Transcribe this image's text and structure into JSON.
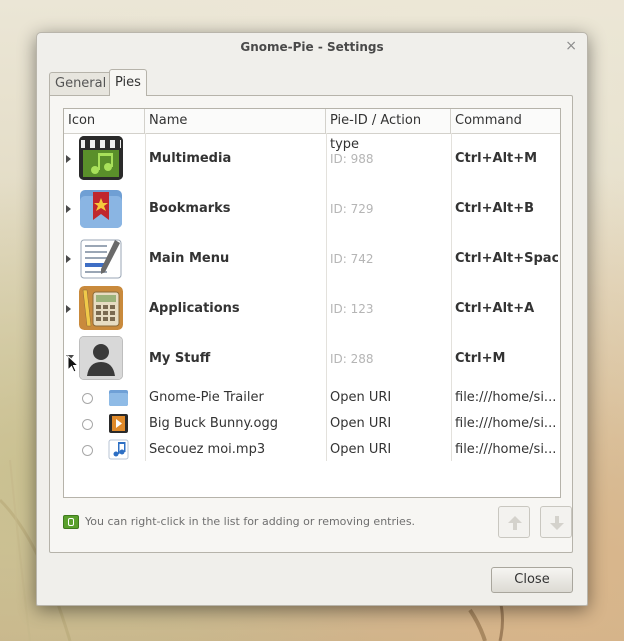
{
  "window": {
    "title": "Gnome-Pie - Settings"
  },
  "tabs": [
    {
      "label": "General",
      "active": false
    },
    {
      "label": "Pies",
      "active": true
    }
  ],
  "columns": {
    "icon": "Icon",
    "name": "Name",
    "pie_id": "Pie-ID / Action type",
    "command": "Command"
  },
  "pies": [
    {
      "name": "Multimedia",
      "id": "ID: 988",
      "command": "Ctrl+Alt+M",
      "icon": "multimedia-clapper-icon",
      "expanded": false
    },
    {
      "name": "Bookmarks",
      "id": "ID: 729",
      "command": "Ctrl+Alt+B",
      "icon": "bookmarks-folder-icon",
      "expanded": false
    },
    {
      "name": "Main Menu",
      "id": "ID: 742",
      "command": "Ctrl+Alt+Space",
      "icon": "main-menu-notepad-icon",
      "expanded": false
    },
    {
      "name": "Applications",
      "id": "ID: 123",
      "command": "Ctrl+Alt+A",
      "icon": "applications-calculator-icon",
      "expanded": false
    },
    {
      "name": "My Stuff",
      "id": "ID: 288",
      "command": "Ctrl+M",
      "icon": "my-stuff-user-icon",
      "expanded": true
    }
  ],
  "slices": [
    {
      "name": "Gnome-Pie Trailer",
      "type": "Open URI",
      "command": "file:///home/si...",
      "icon": "folder-icon"
    },
    {
      "name": "Big Buck Bunny.ogg",
      "type": "Open URI",
      "command": "file:///home/si...",
      "icon": "video-icon"
    },
    {
      "name": "Secouez moi.mp3",
      "type": "Open URI",
      "command": "file:///home/si...",
      "icon": "audio-icon"
    }
  ],
  "hint": "You can right-click in the list for adding or removing entries.",
  "buttons": {
    "close": "Close",
    "move_up": "move-up-arrow-icon",
    "move_down": "move-down-arrow-icon"
  },
  "colors": {
    "window_bg": "#f0efeb",
    "hint_icon": "#5aa02c",
    "id_text": "#b5b5b5"
  }
}
